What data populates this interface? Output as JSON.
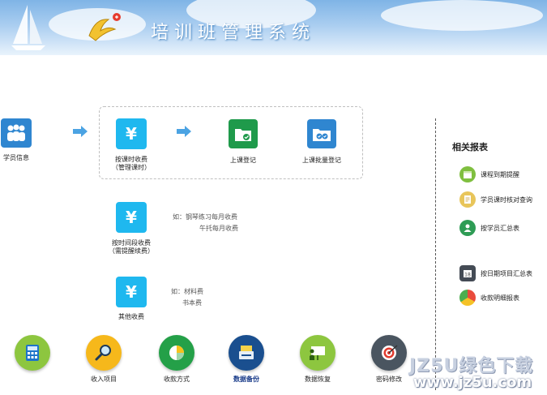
{
  "header": {
    "title": "培训班管理系统"
  },
  "flow": {
    "student_info": "学员信息",
    "fee_by_lesson_line1": "按课时收费",
    "fee_by_lesson_line2": "（管理课时）",
    "class_register": "上课登记",
    "class_batch_register": "上课批量登记",
    "fee_by_period_line1": "按时间段收费",
    "fee_by_period_line2": "（需提醒续费）",
    "period_note_line1": "如：钢琴练习每月收费",
    "period_note_line2": "午托每月收费",
    "other_fee": "其他收费",
    "other_note_line1": "如：材料费",
    "other_note_line2": "书本费"
  },
  "reports": {
    "title": "相关报表",
    "items": [
      {
        "label": "课程到期提醒"
      },
      {
        "label": "学员课时核对查询"
      },
      {
        "label": "按学员汇总表"
      },
      {
        "label": "按日期项目汇总表"
      },
      {
        "label": "收款明细报表"
      }
    ]
  },
  "bottom": {
    "items": [
      {
        "label": ""
      },
      {
        "label": "收入项目"
      },
      {
        "label": "收款方式"
      },
      {
        "label": "数据备份"
      },
      {
        "label": "数据恢复"
      },
      {
        "label": "密码修改"
      }
    ]
  },
  "watermark": {
    "line1": "JZ5U绿色下载",
    "line2": "www.jz5u.com"
  },
  "colors": {
    "cyan": "#1fb8ef",
    "green": "#1f9a4b",
    "blue": "#2f86d0",
    "arrow": "#4ba3e3"
  }
}
